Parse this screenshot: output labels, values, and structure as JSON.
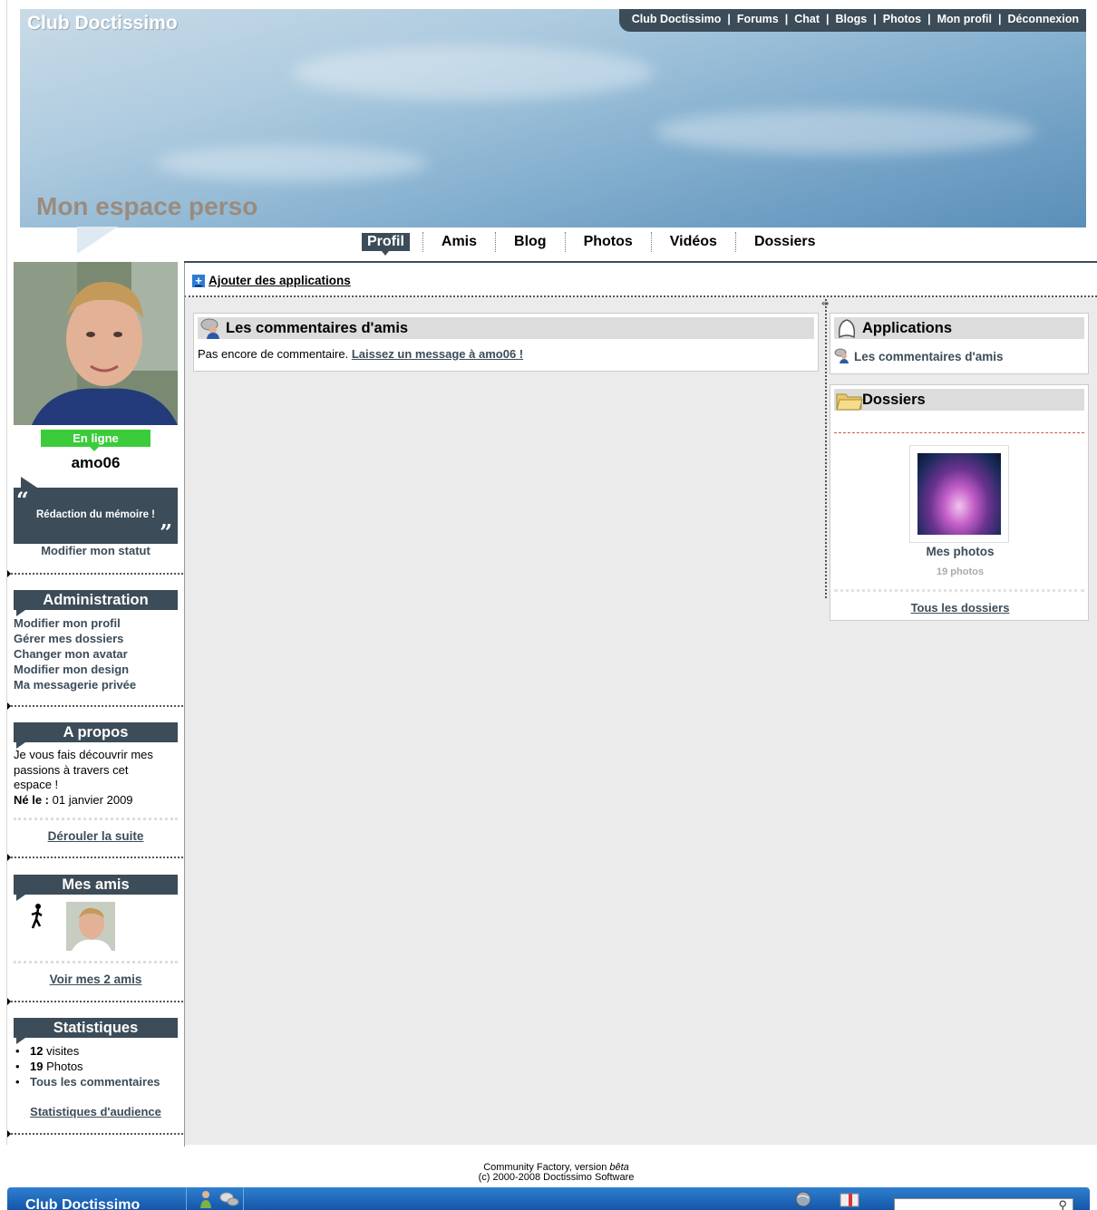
{
  "header": {
    "site_title": "Club Doctissimo",
    "espace_title": "Mon espace perso",
    "topnav": [
      "Club Doctissimo",
      "Forums",
      "Chat",
      "Blogs",
      "Photos",
      "Mon profil",
      "Déconnexion"
    ]
  },
  "tabs": [
    "Profil",
    "Amis",
    "Blog",
    "Photos",
    "Vidéos",
    "Dossiers"
  ],
  "profile": {
    "online": "En ligne",
    "username": "amo06",
    "status": "Rédaction du mémoire !",
    "modify_status": "Modifier mon statut"
  },
  "admin": {
    "title": "Administration",
    "links": [
      "Modifier mon profil",
      "Gérer mes dossiers",
      "Changer mon avatar",
      "Modifier mon design",
      "Ma messagerie privée"
    ]
  },
  "about": {
    "title": "A propos",
    "text1": "Je vous fais découvrir mes",
    "text2": "passions à travers cet",
    "text3": "espace !",
    "born_label": "Né le :",
    "born_value": " 01 janvier 2009",
    "more": "Dérouler la suite"
  },
  "friends": {
    "title": "Mes amis",
    "link": "Voir mes 2 amis"
  },
  "stats": {
    "title": "Statistiques",
    "visits_num": "12",
    "visits_label": " visites",
    "photos_num": "19",
    "photos_label": " Photos",
    "comments_link": "Tous les commentaires",
    "audience_link": "Statistiques d'audience"
  },
  "main": {
    "add_app": "Ajouter des applications",
    "comments": {
      "title": "Les commentaires d'amis",
      "empty": "Pas encore de commentaire. ",
      "leave": "Laissez un message à amo06 !"
    },
    "apps": {
      "title": "Applications",
      "item": "Les commentaires d'amis"
    },
    "dossiers": {
      "title": "Dossiers",
      "album": "Mes photos",
      "count": "19 photos",
      "all": "Tous les dossiers"
    }
  },
  "footer": {
    "line1a": "Community Factory, version ",
    "line1b": "bêta",
    "line2": "(c) 2000-2008 Doctissimo Software",
    "bar_title": "Club Doctissimo"
  },
  "colors": {
    "dark": "#3c4c58",
    "online": "#3bcc3b",
    "bar": "#1f6bc0"
  }
}
